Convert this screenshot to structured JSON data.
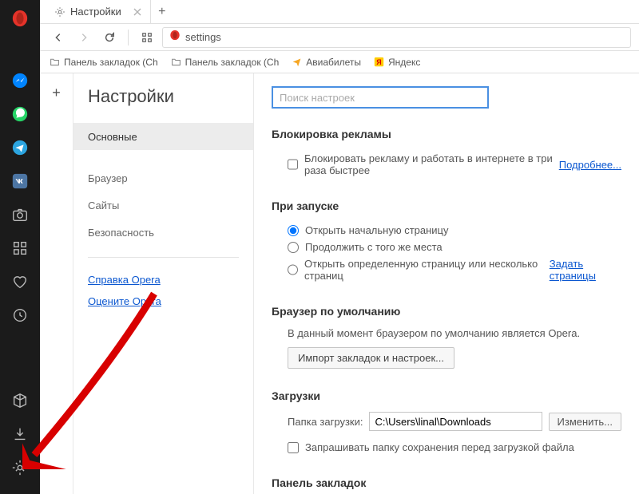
{
  "tab": {
    "title": "Настройки"
  },
  "address": {
    "value": "settings"
  },
  "bookmarks": [
    {
      "label": "Панель закладок (Ch",
      "icon": "folder"
    },
    {
      "label": "Панель закладок (Ch",
      "icon": "folder"
    },
    {
      "label": "Авиабилеты",
      "icon": "plane"
    },
    {
      "label": "Яндекс",
      "icon": "yandex"
    }
  ],
  "settings_nav": {
    "title": "Настройки",
    "items": [
      "Основные",
      "Браузер",
      "Сайты",
      "Безопасность"
    ],
    "active": 0,
    "links": [
      "Справка Opera",
      "Оцените Opera"
    ]
  },
  "search": {
    "placeholder": "Поиск настроек"
  },
  "sections": {
    "adblock": {
      "title": "Блокировка рекламы",
      "checkbox_label": "Блокировать рекламу и работать в интернете в три раза быстрее",
      "more": "Подробнее..."
    },
    "startup": {
      "title": "При запуске",
      "opt1": "Открыть начальную страницу",
      "opt2": "Продолжить с того же места",
      "opt3": "Открыть определенную страницу или несколько страниц",
      "opt3_link": "Задать страницы"
    },
    "default": {
      "title": "Браузер по умолчанию",
      "desc": "В данный момент браузером по умолчанию является Opera.",
      "btn": "Импорт закладок и настроек..."
    },
    "downloads": {
      "title": "Загрузки",
      "label": "Папка загрузки:",
      "path": "C:\\Users\\linal\\Downloads",
      "change": "Изменить...",
      "ask": "Запрашивать папку сохранения перед загрузкой файла"
    },
    "bookmarks_panel": {
      "title": "Панель закладок"
    }
  }
}
